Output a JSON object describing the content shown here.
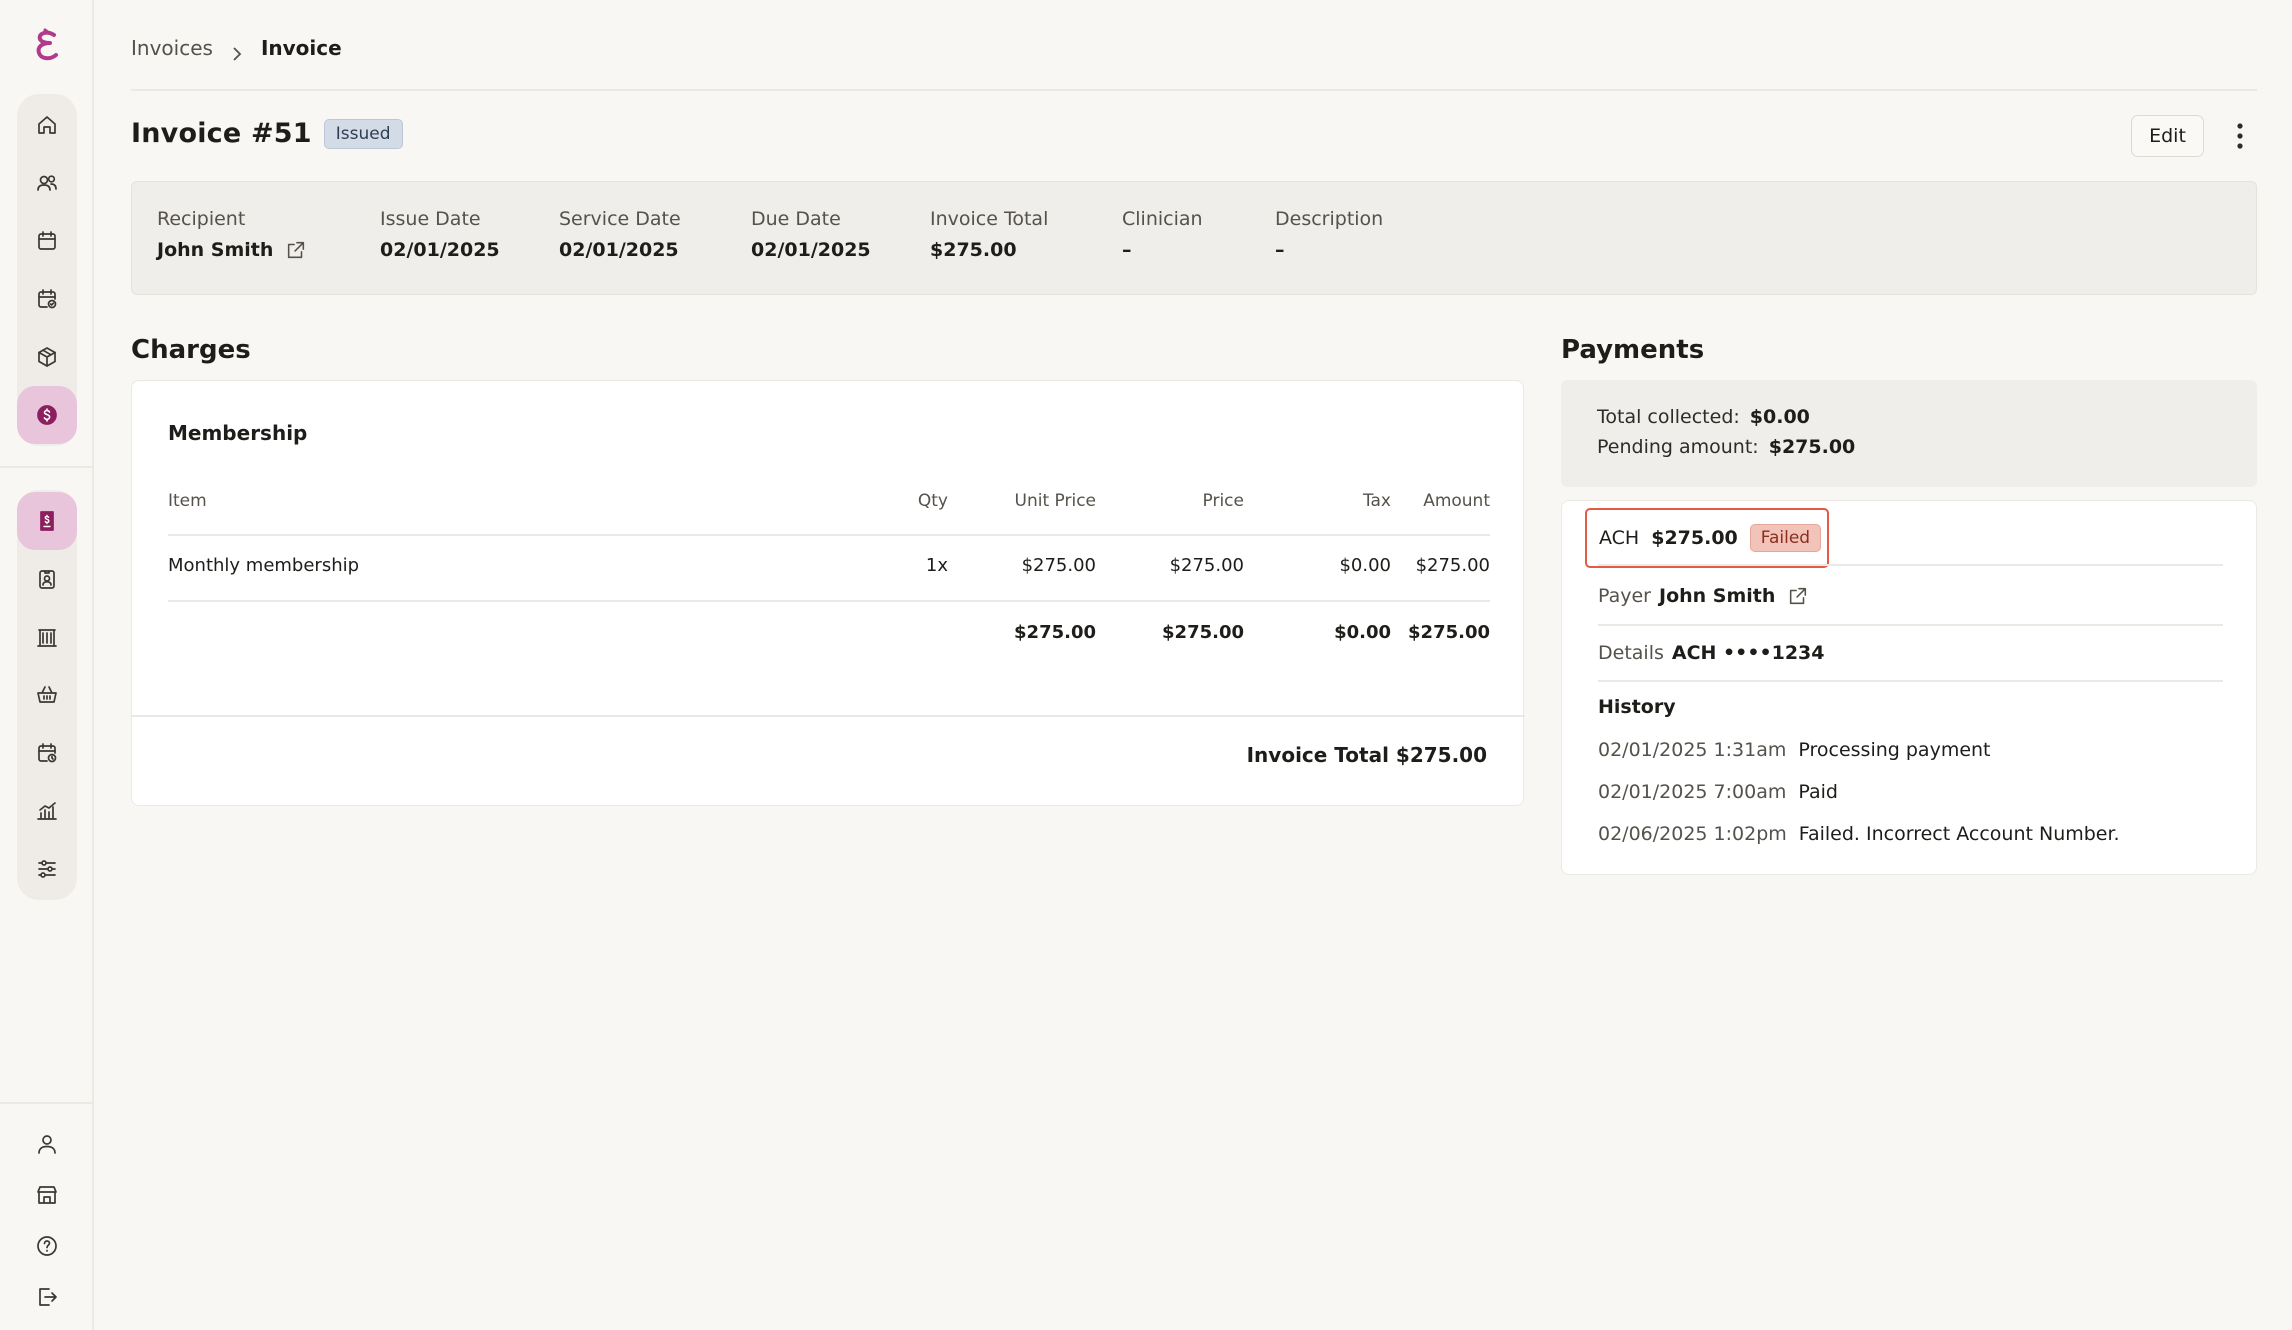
{
  "breadcrumb": {
    "parent": "Invoices",
    "current": "Invoice"
  },
  "header": {
    "title": "Invoice #51",
    "status": "Issued",
    "edit_label": "Edit"
  },
  "summary": {
    "recipient_label": "Recipient",
    "recipient_value": "John Smith",
    "issue_date_label": "Issue Date",
    "issue_date_value": "02/01/2025",
    "service_date_label": "Service Date",
    "service_date_value": "02/01/2025",
    "due_date_label": "Due Date",
    "due_date_value": "02/01/2025",
    "invoice_total_label": "Invoice Total",
    "invoice_total_value": "$275.00",
    "clinician_label": "Clinician",
    "clinician_value": "–",
    "description_label": "Description",
    "description_value": "–"
  },
  "charges": {
    "title": "Charges",
    "group_title": "Membership",
    "columns": {
      "item": "Item",
      "qty": "Qty",
      "unit_price": "Unit Price",
      "price": "Price",
      "tax": "Tax",
      "amount": "Amount"
    },
    "rows": [
      {
        "item": "Monthly membership",
        "qty": "1x",
        "unit_price": "$275.00",
        "price": "$275.00",
        "tax": "$0.00",
        "amount": "$275.00"
      }
    ],
    "totals": {
      "unit_price": "$275.00",
      "price": "$275.00",
      "tax": "$0.00",
      "amount": "$275.00"
    },
    "invoice_total": "Invoice Total $275.00"
  },
  "payments": {
    "title": "Payments",
    "total_collected_label": "Total collected:",
    "total_collected_value": "$0.00",
    "pending_label": "Pending amount:",
    "pending_value": "$275.00",
    "method": "ACH",
    "amount": "$275.00",
    "status": "Failed",
    "payer_label": "Payer",
    "payer_value": "John Smith",
    "details_label": "Details",
    "details_value": "ACH ••••1234",
    "history_title": "History",
    "history": [
      {
        "timestamp": "02/01/2025 1:31am",
        "event": "Processing payment"
      },
      {
        "timestamp": "02/01/2025 7:00am",
        "event": "Paid"
      },
      {
        "timestamp": "02/06/2025 1:02pm",
        "event": "Failed. Incorrect Account Number."
      }
    ]
  },
  "colors": {
    "accent": "#b23a8c",
    "active_nav": "#e9c5db",
    "failed_border": "#e45a45"
  },
  "icons": {
    "nav_top": [
      "home-icon",
      "users-icon",
      "calendar-icon",
      "calendar-check-icon",
      "package-icon",
      "billing-icon"
    ],
    "nav_mid": [
      "invoice-icon",
      "badge-icon",
      "building-icon",
      "basket-icon",
      "calendar-clock-icon",
      "chart-icon",
      "sliders-icon"
    ],
    "nav_bottom": [
      "user-icon",
      "store-icon",
      "help-icon",
      "logout-icon"
    ]
  }
}
